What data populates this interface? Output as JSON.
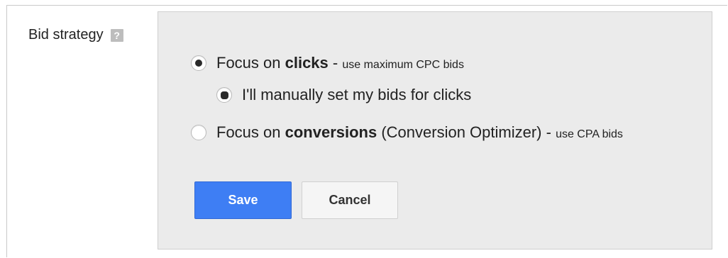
{
  "section": {
    "label": "Bid strategy",
    "help_icon": "?"
  },
  "options": {
    "clicks": {
      "prefix": "Focus on ",
      "bold": "clicks",
      "suffix": " - ",
      "note": "use maximum CPC bids",
      "selected": true
    },
    "manual": {
      "label": "I'll manually set my bids for clicks",
      "selected": true
    },
    "conversions": {
      "prefix": "Focus on ",
      "bold": "conversions",
      "suffix": " (Conversion Optimizer) - ",
      "note": "use CPA bids",
      "selected": false
    }
  },
  "buttons": {
    "save": "Save",
    "cancel": "Cancel"
  },
  "colors": {
    "save_bg": "#3e7ef4",
    "panel_bg": "#ebebeb"
  }
}
